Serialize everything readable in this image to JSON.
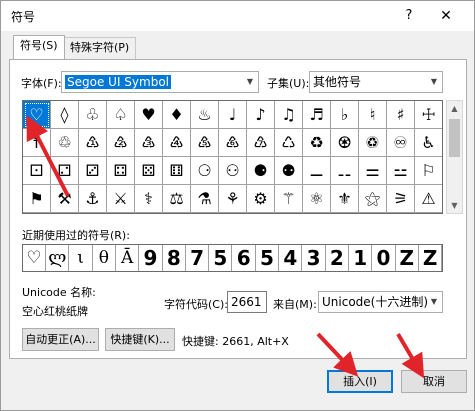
{
  "dialog": {
    "title": "符号",
    "help_label": "?",
    "close_label": "✕"
  },
  "tabs": [
    {
      "label": "符号(S)",
      "active": true
    },
    {
      "label": "特殊字符(P)",
      "active": false
    }
  ],
  "font": {
    "label": "字体(F):",
    "value": "Segoe UI Symbol"
  },
  "subset": {
    "label": "子集(U):",
    "value": "其他符号"
  },
  "symbol_grid": {
    "rows": [
      [
        "♡",
        "◊",
        "♧",
        "♤",
        "♥",
        "♦",
        "♨",
        "♩",
        "♪",
        "♫",
        "♬",
        "♭",
        "♮",
        "♯",
        "☩"
      ],
      [
        "☨",
        "♲",
        "♳",
        "♴",
        "♵",
        "♶",
        "♷",
        "♸",
        "♹",
        "♺",
        "♻",
        "♼",
        "♽",
        "♾",
        "♿"
      ],
      [
        "⚀",
        "⚁",
        "⚂",
        "⚃",
        "⚄",
        "⚅",
        "⚆",
        "⚇",
        "⚈",
        "⚉",
        "⚊",
        "⚋",
        "⚌",
        "⚍",
        "⚐"
      ],
      [
        "⚑",
        "⚒",
        "⚓",
        "⚔",
        "⚕",
        "⚖",
        "⚗",
        "⚘",
        "⚙",
        "⚚",
        "⚛",
        "⚜",
        "⚝",
        "⚞",
        "⚠"
      ]
    ],
    "selected": "♡"
  },
  "recent": {
    "label": "近期使用过的符号(R):",
    "symbols": [
      "♡",
      "ლ",
      "ι",
      "θ",
      "Ā",
      "9",
      "8",
      "7",
      "5",
      "6",
      "5",
      "4",
      "3",
      "2",
      "1",
      "0",
      "Z",
      "Z"
    ]
  },
  "unicode": {
    "name_label": "Unicode 名称:",
    "name_value": "空心红桃纸牌"
  },
  "char_code": {
    "label": "字符代码(C):",
    "value": "2661"
  },
  "from": {
    "label": "来自(M):",
    "value": "Unicode(十六进制)"
  },
  "buttons": {
    "autocorrect": "自动更正(A)...",
    "shortcut_key": "快捷键(K)...",
    "shortcut_text": "快捷键: 2661, Alt+X",
    "insert": "插入(I)",
    "cancel": "取消"
  },
  "annotation_color": "#e0242a",
  "selection_color": "#0078d7"
}
